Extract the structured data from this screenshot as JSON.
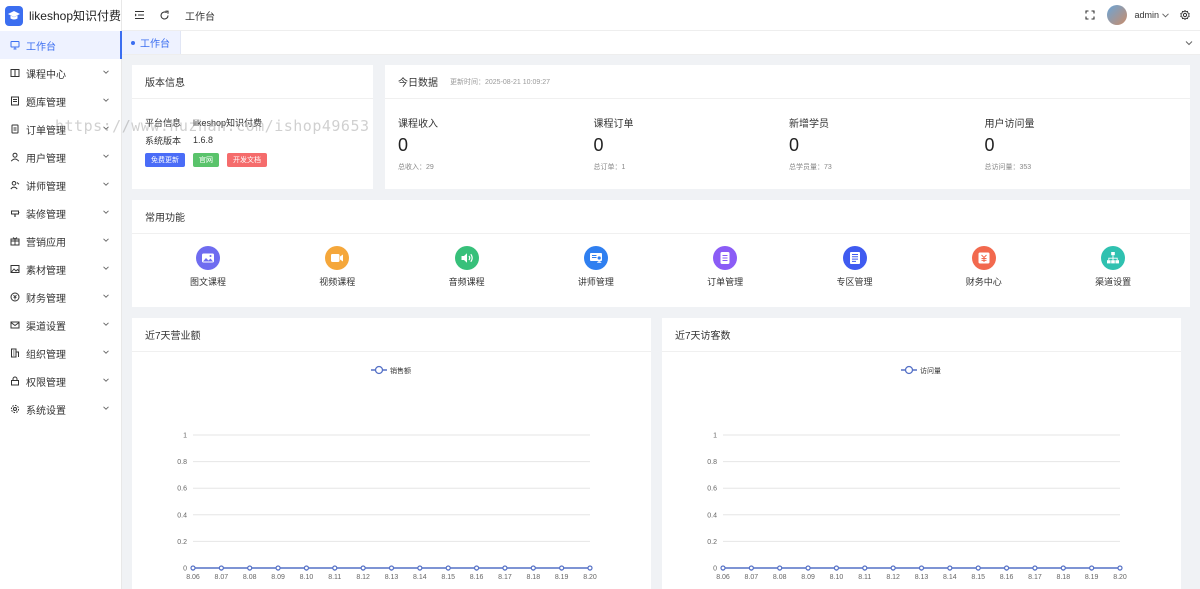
{
  "app": {
    "title": "likeshop知识付费"
  },
  "sidebar": {
    "items": [
      {
        "label": "工作台",
        "icon": "monitor-icon",
        "active": true,
        "expandable": false
      },
      {
        "label": "课程中心",
        "icon": "book-icon",
        "expandable": true
      },
      {
        "label": "题库管理",
        "icon": "list-icon",
        "expandable": true
      },
      {
        "label": "订单管理",
        "icon": "order-icon",
        "expandable": true
      },
      {
        "label": "用户管理",
        "icon": "user-icon",
        "expandable": true
      },
      {
        "label": "讲师管理",
        "icon": "teacher-icon",
        "expandable": true
      },
      {
        "label": "装修管理",
        "icon": "decor-icon",
        "expandable": true
      },
      {
        "label": "营销应用",
        "icon": "marketing-icon",
        "expandable": true
      },
      {
        "label": "素材管理",
        "icon": "image-icon",
        "expandable": true
      },
      {
        "label": "财务管理",
        "icon": "finance-icon",
        "expandable": true
      },
      {
        "label": "渠道设置",
        "icon": "mail-icon",
        "expandable": true
      },
      {
        "label": "组织管理",
        "icon": "building-icon",
        "expandable": true
      },
      {
        "label": "权限管理",
        "icon": "lock-icon",
        "expandable": true
      },
      {
        "label": "系统设置",
        "icon": "gear-icon",
        "expandable": true
      }
    ]
  },
  "header": {
    "breadcrumb": "工作台",
    "user": "admin"
  },
  "tabs": [
    {
      "label": "工作台"
    }
  ],
  "watermark": "https://www.huzhan.com/ishop49653",
  "version": {
    "title": "版本信息",
    "platform_label": "平台信息",
    "platform_value": "likeshop知识付费",
    "version_label": "系统版本",
    "version_value": "1.6.8",
    "buttons": [
      {
        "label": "免费更新",
        "color": "#4a6cf7"
      },
      {
        "label": "官网",
        "color": "#5ac36b"
      },
      {
        "label": "开发文档",
        "color": "#f56c6c"
      }
    ]
  },
  "today": {
    "title": "今日数据",
    "updated": "更新时间：2025-08-21 10:09:27",
    "stats": [
      {
        "label": "课程收入",
        "value": "0",
        "total": "总收入：29"
      },
      {
        "label": "课程订单",
        "value": "0",
        "total": "总订单：1"
      },
      {
        "label": "新增学员",
        "value": "0",
        "total": "总学员量：73"
      },
      {
        "label": "用户访问量",
        "value": "0",
        "total": "总访问量：353"
      }
    ]
  },
  "shortcuts": {
    "title": "常用功能",
    "items": [
      {
        "label": "图文课程",
        "icon": "picture-icon",
        "color": "#6f6cf0"
      },
      {
        "label": "视频课程",
        "icon": "video-icon",
        "color": "#f5a73b"
      },
      {
        "label": "音频课程",
        "icon": "audio-icon",
        "color": "#37c07a"
      },
      {
        "label": "讲师管理",
        "icon": "teacher-icon",
        "color": "#2f7ff0"
      },
      {
        "label": "订单管理",
        "icon": "order-icon",
        "color": "#8b5cf6"
      },
      {
        "label": "专区管理",
        "icon": "zone-icon",
        "color": "#3f5bf0"
      },
      {
        "label": "财务中心",
        "icon": "finance-icon",
        "color": "#f2694e"
      },
      {
        "label": "渠道设置",
        "icon": "channel-icon",
        "color": "#2fc1b0"
      }
    ]
  },
  "charts": [
    {
      "title": "近7天营业额"
    },
    {
      "title": "近7天访客数"
    }
  ],
  "chart_data": [
    {
      "type": "line",
      "x": [
        "8.06",
        "8.07",
        "8.08",
        "8.09",
        "8.10",
        "8.11",
        "8.12",
        "8.13",
        "8.14",
        "8.15",
        "8.16",
        "8.17",
        "8.18",
        "8.19",
        "8.20"
      ],
      "series": [
        {
          "name": "销售额",
          "values": [
            0,
            0,
            0,
            0,
            0,
            0,
            0,
            0,
            0,
            0,
            0,
            0,
            0,
            0,
            0
          ]
        }
      ],
      "yticks": [
        "0",
        "0.2",
        "0.4",
        "0.6",
        "0.8",
        "1"
      ],
      "ylim": [
        0,
        1
      ],
      "legend": "top-center",
      "grid": true,
      "color": "#5470c6"
    },
    {
      "type": "line",
      "x": [
        "8.06",
        "8.07",
        "8.08",
        "8.09",
        "8.10",
        "8.11",
        "8.12",
        "8.13",
        "8.14",
        "8.15",
        "8.16",
        "8.17",
        "8.18",
        "8.19",
        "8.20"
      ],
      "series": [
        {
          "name": "访问量",
          "values": [
            0,
            0,
            0,
            0,
            0,
            0,
            0,
            0,
            0,
            0,
            0,
            0,
            0,
            0,
            0
          ]
        }
      ],
      "yticks": [
        "0",
        "0.2",
        "0.4",
        "0.6",
        "0.8",
        "1"
      ],
      "ylim": [
        0,
        1
      ],
      "legend": "top-center",
      "grid": true,
      "color": "#5470c6"
    }
  ]
}
